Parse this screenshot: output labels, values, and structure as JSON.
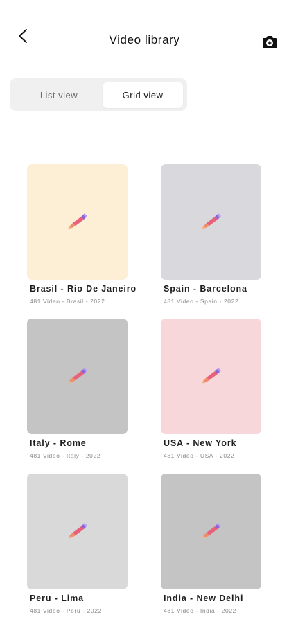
{
  "header": {
    "title": "Video library",
    "back_icon": "chevron-left-icon",
    "camera_icon": "camera-add-icon"
  },
  "view_toggle": {
    "list_label": "List view",
    "grid_label": "Grid view",
    "selected": "Grid view"
  },
  "placeholder_icon": "pencil-icon",
  "cards": [
    {
      "title": "Brasil - Rio De Janeiro",
      "subtitle": "481 Video - Brasil - 2022",
      "color": "#fdefd6"
    },
    {
      "title": "Spain - Barcelona",
      "subtitle": "481 Video - Spain - 2022",
      "color": "#d9d9dd"
    },
    {
      "title": "Italy - Rome",
      "subtitle": "481 Video - Italy - 2022",
      "color": "#c4c4c4"
    },
    {
      "title": "USA - New York",
      "subtitle": "481 Video - USA - 2022",
      "color": "#f8d7da"
    },
    {
      "title": "Peru - Lima",
      "subtitle": "481 Video - Peru - 2022",
      "color": "#d9d9d9"
    },
    {
      "title": "India - New Delhi",
      "subtitle": "481 Video - India - 2022",
      "color": "#c4c4c4"
    }
  ]
}
